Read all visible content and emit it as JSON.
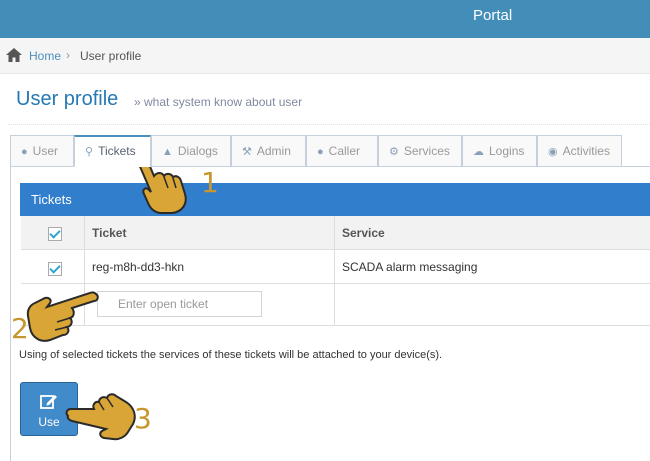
{
  "header": {
    "title": "Portal"
  },
  "breadcrumb": {
    "home": "Home",
    "separator": "›",
    "current": "User profile"
  },
  "page": {
    "title": "User profile",
    "subtitle": "» what system know about user"
  },
  "tabs": [
    {
      "label": "User",
      "icon": "user-icon"
    },
    {
      "label": "Tickets",
      "icon": "key-icon",
      "active": true
    },
    {
      "label": "Dialogs",
      "icon": "bullhorn-icon"
    },
    {
      "label": "Admin",
      "icon": "wrench-icon"
    },
    {
      "label": "Caller",
      "icon": "comment-icon"
    },
    {
      "label": "Services",
      "icon": "cogs-icon"
    },
    {
      "label": "Logins",
      "icon": "cloud-upload-icon"
    },
    {
      "label": "Activities",
      "icon": "eye-icon"
    }
  ],
  "tickets_widget": {
    "title": "Tickets",
    "columns": [
      "Ticket",
      "Service"
    ],
    "rows": [
      {
        "checked": true,
        "ticket": "reg-m8h-dd3-hkn",
        "service": "SCADA alarm messaging"
      }
    ],
    "input": {
      "placeholder": "Enter open ticket",
      "value": ""
    }
  },
  "info_text": "Using of selected tickets the services of these tickets will be attached to your device(s).",
  "use_button": {
    "label": "Use",
    "icon": "edit-icon"
  },
  "annotations": [
    "1",
    "2",
    "3"
  ],
  "colors": {
    "topbar": "#438eb9",
    "accent": "#307ecc",
    "button": "#428bca",
    "annotation": "#c8962e"
  }
}
